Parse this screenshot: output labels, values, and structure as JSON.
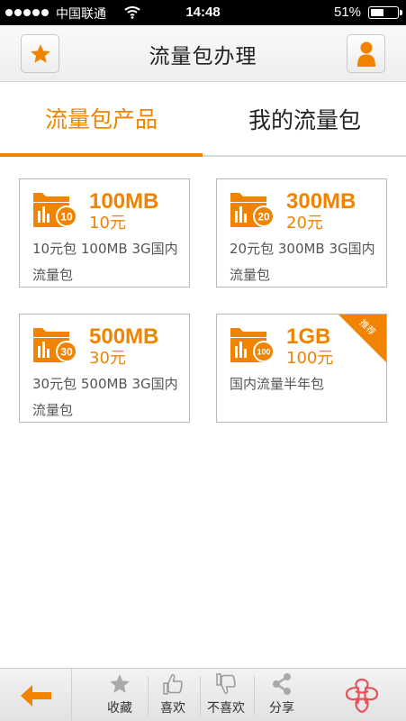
{
  "status_bar": {
    "carrier": "中国联通",
    "time": "14:48",
    "battery": "51%",
    "battery_level": 0.51
  },
  "header": {
    "title": "流量包办理",
    "left_icon": "star-icon",
    "right_icon": "user-icon"
  },
  "tabs": [
    {
      "label": "流量包产品",
      "active": true
    },
    {
      "label": "我的流量包",
      "active": false
    }
  ],
  "packages": [
    {
      "badge": "10",
      "size": "100MB",
      "price": "10元",
      "desc": "10元包 100MB 3G国内流量包"
    },
    {
      "badge": "20",
      "size": "300MB",
      "price": "20元",
      "desc": "20元包 300MB 3G国内流量包"
    },
    {
      "badge": "30",
      "size": "500MB",
      "price": "30元",
      "desc": "30元包 500MB 3G国内流量包"
    },
    {
      "badge": "100",
      "size": "1GB",
      "price": "100元",
      "desc": "国内流量半年包",
      "tag": "推荐"
    }
  ],
  "bottom_bar": {
    "back_icon": "arrow-left-icon",
    "items": [
      {
        "label": "收藏",
        "icon": "star-icon"
      },
      {
        "label": "喜欢",
        "icon": "thumbs-up-icon"
      },
      {
        "label": "不喜欢",
        "icon": "thumbs-down-icon"
      },
      {
        "label": "分享",
        "icon": "share-icon"
      }
    ],
    "logo": "china-unicom-logo"
  },
  "colors": {
    "accent": "#f08300",
    "status_bar": "#000000",
    "card_border": "#b9b9b9"
  }
}
